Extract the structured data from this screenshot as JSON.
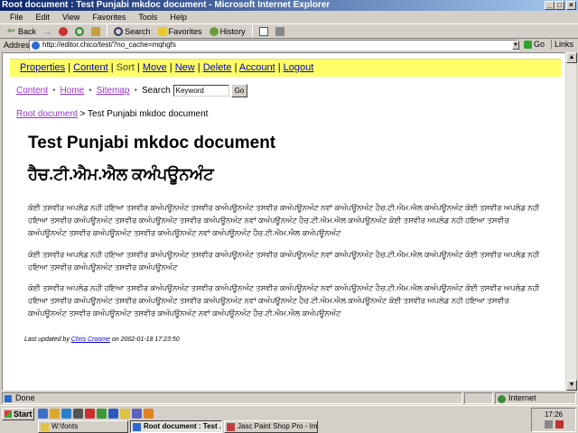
{
  "window": {
    "title": "Root document : Test Punjabi mkdoc document - Microsoft Internet Explorer",
    "minimize": "_",
    "maximize": "□",
    "close": "×"
  },
  "menubar": [
    "File",
    "Edit",
    "View",
    "Favorites",
    "Tools",
    "Help"
  ],
  "toolbar": {
    "back": "Back",
    "forward": "→",
    "search": "Search",
    "favorites": "Favorites",
    "history": "History"
  },
  "address": {
    "label": "Address",
    "url": "http://editor.chico/test/?no_cache=mqhgfs",
    "go": "Go",
    "links": "Links"
  },
  "cms_menu": {
    "items": [
      {
        "label": "Properties",
        "link": true
      },
      {
        "label": "Content",
        "link": true
      },
      {
        "label": "Sort",
        "link": false
      },
      {
        "label": "Move",
        "link": true
      },
      {
        "label": "New",
        "link": true
      },
      {
        "label": "Delete",
        "link": true
      },
      {
        "label": "Account",
        "link": true
      },
      {
        "label": "Logout",
        "link": true
      }
    ],
    "separator": "|"
  },
  "nav": {
    "content": "Content",
    "home": "Home",
    "sitemap": "Sitemap",
    "search_label": "Search",
    "search_value": "Keyword",
    "go": "Go",
    "dot": "•"
  },
  "breadcrumb": {
    "root": "Root document",
    "separator": " > ",
    "current": "Test Punjabi mkdoc document"
  },
  "document": {
    "title": "Test Punjabi mkdoc document",
    "subtitle": "ਹੈਚ.ਟੀ.ਐਮ.ਐਲ ਕਅੰਪਊਨਅੰਟ",
    "paragraphs": [
      "ਕੋਈ ਤਸਵੀਰ ਅਪਲੋਡ ਨਹੀ ਹਇਆ ਤਸਵੀਰ ਕਅੰਪਊਨਅੰਟ ਤਸਵੀਰ ਕਅੰਪਊਨਅੰਟ ਤਸਵੀਰ ਕਅੰਪਊਨਅੰਟ ਨਵਾਂ ਕਅੰਪਊਨਅੰਟ ਹੈਚ.ਟੀ.ਐਮ.ਐਲ ਕਅੰਪਊਨਅੰਟ ਕੋਈ ਤਸਵੀਰ ਅਪਲੋਡ ਨਹੀ ਹਇਆ ਤਸਵੀਰ ਕਅੰਪਊਨਅੰਟ ਤਸਵੀਰ ਕਅੰਪਊਨਅੰਟ ਤਸਵੀਰ ਕਅੰਪਊਨਅੰਟ ਨਵਾਂ ਕਅੰਪਊਨਅੰਟ ਹੈਚ.ਟੀ.ਐਮ.ਐਲ ਕਅੰਪਊਨਅੰਟ ਕੋਈ ਤਸਵੀਰ ਅਪਲੋਡ ਨਹੀ ਹਇਆ ਤਸਵੀਰ ਕਅੰਪਊਨਅੰਟ ਤਸਵੀਰ ਕਅੰਪਊਨਅੰਟ ਤਸਵੀਰ ਕਅੰਪਊਨਅੰਟ ਨਵਾਂ ਕਅੰਪਊਨਅੰਟ ਹੈਚ.ਟੀ.ਐਮ.ਐਲ ਕਅੰਪਊਨਅੰਟ",
      "ਕੋਈ ਤਸਵੀਰ ਅਪਲੋਡ ਨਹੀ ਹਇਆ ਤਸਵੀਰ ਕਅੰਪਊਨਅੰਟ ਤਸਵੀਰ ਕਅੰਪਊਨਅੰਟ ਤਸਵੀਰ ਕਅੰਪਊਨਅੰਟ ਨਵਾਂ ਕਅੰਪਊਨਅੰਟ ਹੈਚ.ਟੀ.ਐਮ.ਐਲ ਕਅੰਪਊਨਅੰਟ ਕੋਈ ਤਸਵੀਰ ਅਪਲੋਡ ਨਹੀ ਹਇਆ ਤਸਵੀਰ ਕਅੰਪਊਨਅੰਟ ਤਸਵੀਰ ਕਅੰਪਊਨਅੰਟ",
      "ਕੋਈ ਤਸਵੀਰ ਅਪਲੋਡ ਨਹੀ ਹਇਆ ਤਸਵੀਰ ਕਅੰਪਊਨਅੰਟ ਤਸਵੀਰ ਕਅੰਪਊਨਅੰਟ ਤਸਵੀਰ ਕਅੰਪਊਨਅੰਟ ਨਵਾਂ ਕਅੰਪਊਨਅੰਟ ਹੈਚ.ਟੀ.ਐਮ.ਐਲ ਕਅੰਪਊਨਅੰਟ ਕੋਈ ਤਸਵੀਰ ਅਪਲੋਡ ਨਹੀ ਹਇਆ ਤਸਵੀਰ ਕਅੰਪਊਨਅੰਟ ਤਸਵੀਰ ਕਅੰਪਊਨਅੰਟ ਤਸਵੀਰ ਕਅੰਪਊਨਅੰਟ ਨਵਾਂ ਕਅੰਪਊਨਅੰਟ ਹੈਚ.ਟੀ.ਐਮ.ਐਲ ਕਅੰਪਊਨਅੰਟ ਕੋਈ ਤਸਵੀਰ ਅਪਲੋਡ ਨਹੀ ਹਇਆ ਤਸਵੀਰ ਕਅੰਪਊਨਅੰਟ ਤਸਵੀਰ ਕਅੰਪਊਨਅੰਟ ਤਸਵੀਰ ਕਅੰਪਊਨਅੰਟ ਨਵਾਂ ਕਅੰਪਊਨਅੰਟ ਹੈਚ.ਟੀ.ਐਮ.ਐਲ ਕਅੰਪਊਨਅੰਟ"
    ],
    "updated_prefix": "Last updated by",
    "updated_author": "Chris Croome",
    "updated_suffix": "on 2002-01-18 17:23:50"
  },
  "status": {
    "text": "Done",
    "zone": "Internet"
  },
  "taskbar": {
    "start": "Start",
    "tasks": [
      {
        "label": "W:\\fonts",
        "active": false
      },
      {
        "label": "Root document : Test ...",
        "active": true
      },
      {
        "label": "Jasc Paint Shop Pro - Ima...",
        "active": false
      }
    ],
    "clock": "17:26"
  }
}
